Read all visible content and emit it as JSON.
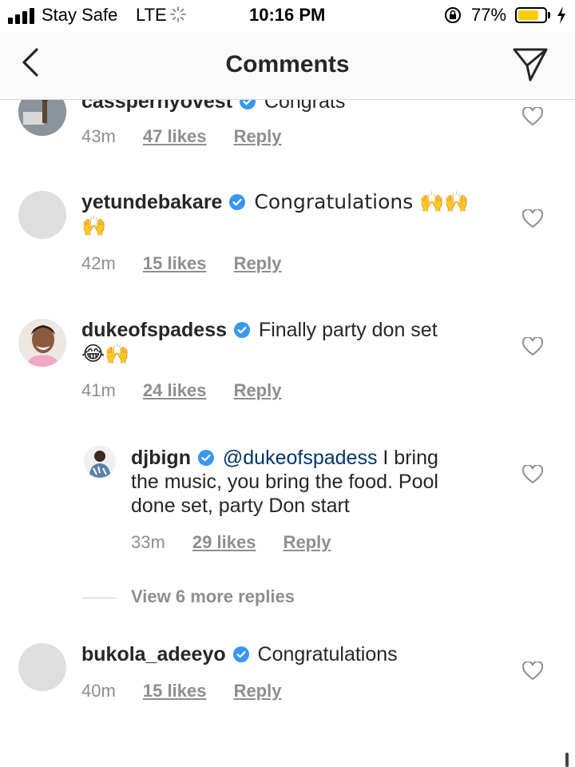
{
  "status_bar": {
    "carrier": "Stay Safe",
    "network": "LTE",
    "time": "10:16 PM",
    "battery_percent": "77%",
    "battery_level": 0.77
  },
  "header": {
    "title": "Comments"
  },
  "comments": [
    {
      "username": "casspernyovest",
      "text": "Congrats",
      "age": "43m",
      "likes": "47 likes",
      "reply": "Reply"
    },
    {
      "username": "yetundebakare",
      "text": "Congratulations 🙌🙌",
      "text2": "🙌",
      "age": "42m",
      "likes": "15 likes",
      "reply": "Reply"
    },
    {
      "username": "dukeofspadess",
      "text": "Finally party don set",
      "text2": "😂🙌",
      "age": "41m",
      "likes": "24 likes",
      "reply": "Reply"
    },
    {
      "username": "djbign",
      "mention": "@dukeofspadess",
      "text": " I bring",
      "text2": "the music, you bring the food. Pool",
      "text3": "done set, party Don start",
      "age": "33m",
      "likes": "29 likes",
      "reply": "Reply"
    },
    {
      "username": "bukola_adeeyo",
      "text": "Congratulations",
      "age": "40m",
      "likes": "15 likes",
      "reply": "Reply"
    }
  ],
  "view_more_replies": "View 6 more replies",
  "colors": {
    "verified": "#3897f0",
    "mention": "#003569",
    "meta": "#8e8e8e",
    "battery": "#ffcc00"
  },
  "icons": [
    "back-chevron-icon",
    "send-icon",
    "verified-icon",
    "heart-icon",
    "lock-rotation-icon",
    "charging-icon"
  ]
}
